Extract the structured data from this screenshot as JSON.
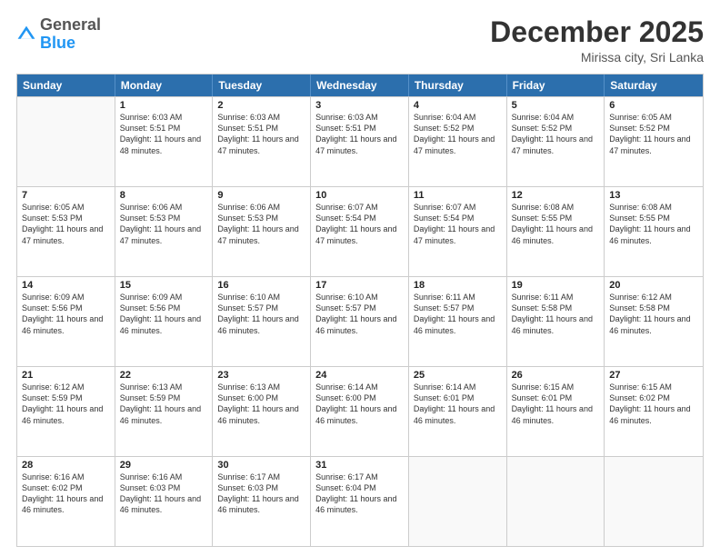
{
  "header": {
    "logo_general": "General",
    "logo_blue": "Blue",
    "month": "December 2025",
    "location": "Mirissa city, Sri Lanka"
  },
  "days_of_week": [
    "Sunday",
    "Monday",
    "Tuesday",
    "Wednesday",
    "Thursday",
    "Friday",
    "Saturday"
  ],
  "weeks": [
    [
      {
        "day": "",
        "sunrise": "",
        "sunset": "",
        "daylight": ""
      },
      {
        "day": "1",
        "sunrise": "Sunrise: 6:03 AM",
        "sunset": "Sunset: 5:51 PM",
        "daylight": "Daylight: 11 hours and 48 minutes."
      },
      {
        "day": "2",
        "sunrise": "Sunrise: 6:03 AM",
        "sunset": "Sunset: 5:51 PM",
        "daylight": "Daylight: 11 hours and 47 minutes."
      },
      {
        "day": "3",
        "sunrise": "Sunrise: 6:03 AM",
        "sunset": "Sunset: 5:51 PM",
        "daylight": "Daylight: 11 hours and 47 minutes."
      },
      {
        "day": "4",
        "sunrise": "Sunrise: 6:04 AM",
        "sunset": "Sunset: 5:52 PM",
        "daylight": "Daylight: 11 hours and 47 minutes."
      },
      {
        "day": "5",
        "sunrise": "Sunrise: 6:04 AM",
        "sunset": "Sunset: 5:52 PM",
        "daylight": "Daylight: 11 hours and 47 minutes."
      },
      {
        "day": "6",
        "sunrise": "Sunrise: 6:05 AM",
        "sunset": "Sunset: 5:52 PM",
        "daylight": "Daylight: 11 hours and 47 minutes."
      }
    ],
    [
      {
        "day": "7",
        "sunrise": "Sunrise: 6:05 AM",
        "sunset": "Sunset: 5:53 PM",
        "daylight": "Daylight: 11 hours and 47 minutes."
      },
      {
        "day": "8",
        "sunrise": "Sunrise: 6:06 AM",
        "sunset": "Sunset: 5:53 PM",
        "daylight": "Daylight: 11 hours and 47 minutes."
      },
      {
        "day": "9",
        "sunrise": "Sunrise: 6:06 AM",
        "sunset": "Sunset: 5:53 PM",
        "daylight": "Daylight: 11 hours and 47 minutes."
      },
      {
        "day": "10",
        "sunrise": "Sunrise: 6:07 AM",
        "sunset": "Sunset: 5:54 PM",
        "daylight": "Daylight: 11 hours and 47 minutes."
      },
      {
        "day": "11",
        "sunrise": "Sunrise: 6:07 AM",
        "sunset": "Sunset: 5:54 PM",
        "daylight": "Daylight: 11 hours and 47 minutes."
      },
      {
        "day": "12",
        "sunrise": "Sunrise: 6:08 AM",
        "sunset": "Sunset: 5:55 PM",
        "daylight": "Daylight: 11 hours and 46 minutes."
      },
      {
        "day": "13",
        "sunrise": "Sunrise: 6:08 AM",
        "sunset": "Sunset: 5:55 PM",
        "daylight": "Daylight: 11 hours and 46 minutes."
      }
    ],
    [
      {
        "day": "14",
        "sunrise": "Sunrise: 6:09 AM",
        "sunset": "Sunset: 5:56 PM",
        "daylight": "Daylight: 11 hours and 46 minutes."
      },
      {
        "day": "15",
        "sunrise": "Sunrise: 6:09 AM",
        "sunset": "Sunset: 5:56 PM",
        "daylight": "Daylight: 11 hours and 46 minutes."
      },
      {
        "day": "16",
        "sunrise": "Sunrise: 6:10 AM",
        "sunset": "Sunset: 5:57 PM",
        "daylight": "Daylight: 11 hours and 46 minutes."
      },
      {
        "day": "17",
        "sunrise": "Sunrise: 6:10 AM",
        "sunset": "Sunset: 5:57 PM",
        "daylight": "Daylight: 11 hours and 46 minutes."
      },
      {
        "day": "18",
        "sunrise": "Sunrise: 6:11 AM",
        "sunset": "Sunset: 5:57 PM",
        "daylight": "Daylight: 11 hours and 46 minutes."
      },
      {
        "day": "19",
        "sunrise": "Sunrise: 6:11 AM",
        "sunset": "Sunset: 5:58 PM",
        "daylight": "Daylight: 11 hours and 46 minutes."
      },
      {
        "day": "20",
        "sunrise": "Sunrise: 6:12 AM",
        "sunset": "Sunset: 5:58 PM",
        "daylight": "Daylight: 11 hours and 46 minutes."
      }
    ],
    [
      {
        "day": "21",
        "sunrise": "Sunrise: 6:12 AM",
        "sunset": "Sunset: 5:59 PM",
        "daylight": "Daylight: 11 hours and 46 minutes."
      },
      {
        "day": "22",
        "sunrise": "Sunrise: 6:13 AM",
        "sunset": "Sunset: 5:59 PM",
        "daylight": "Daylight: 11 hours and 46 minutes."
      },
      {
        "day": "23",
        "sunrise": "Sunrise: 6:13 AM",
        "sunset": "Sunset: 6:00 PM",
        "daylight": "Daylight: 11 hours and 46 minutes."
      },
      {
        "day": "24",
        "sunrise": "Sunrise: 6:14 AM",
        "sunset": "Sunset: 6:00 PM",
        "daylight": "Daylight: 11 hours and 46 minutes."
      },
      {
        "day": "25",
        "sunrise": "Sunrise: 6:14 AM",
        "sunset": "Sunset: 6:01 PM",
        "daylight": "Daylight: 11 hours and 46 minutes."
      },
      {
        "day": "26",
        "sunrise": "Sunrise: 6:15 AM",
        "sunset": "Sunset: 6:01 PM",
        "daylight": "Daylight: 11 hours and 46 minutes."
      },
      {
        "day": "27",
        "sunrise": "Sunrise: 6:15 AM",
        "sunset": "Sunset: 6:02 PM",
        "daylight": "Daylight: 11 hours and 46 minutes."
      }
    ],
    [
      {
        "day": "28",
        "sunrise": "Sunrise: 6:16 AM",
        "sunset": "Sunset: 6:02 PM",
        "daylight": "Daylight: 11 hours and 46 minutes."
      },
      {
        "day": "29",
        "sunrise": "Sunrise: 6:16 AM",
        "sunset": "Sunset: 6:03 PM",
        "daylight": "Daylight: 11 hours and 46 minutes."
      },
      {
        "day": "30",
        "sunrise": "Sunrise: 6:17 AM",
        "sunset": "Sunset: 6:03 PM",
        "daylight": "Daylight: 11 hours and 46 minutes."
      },
      {
        "day": "31",
        "sunrise": "Sunrise: 6:17 AM",
        "sunset": "Sunset: 6:04 PM",
        "daylight": "Daylight: 11 hours and 46 minutes."
      },
      {
        "day": "",
        "sunrise": "",
        "sunset": "",
        "daylight": ""
      },
      {
        "day": "",
        "sunrise": "",
        "sunset": "",
        "daylight": ""
      },
      {
        "day": "",
        "sunrise": "",
        "sunset": "",
        "daylight": ""
      }
    ]
  ]
}
